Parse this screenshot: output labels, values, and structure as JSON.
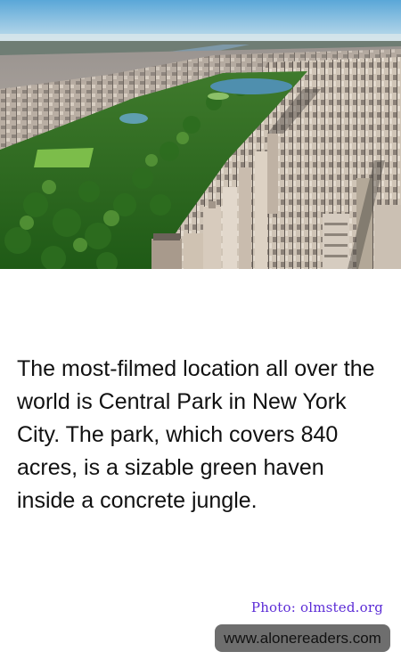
{
  "fact": {
    "text": "The most-filmed location all over the world is Central Park in New York City. The park, which covers 840 acres, is a sizable green haven inside a concrete jungle."
  },
  "photo": {
    "subject": "aerial-view-central-park",
    "credit": "Photo: olmsted.org"
  },
  "site": {
    "url": "www.alonereaders.com"
  },
  "colors": {
    "credit": "#5b2bd6",
    "badge": "#6e6e6e",
    "text": "#111111",
    "background": "#ffffff"
  }
}
